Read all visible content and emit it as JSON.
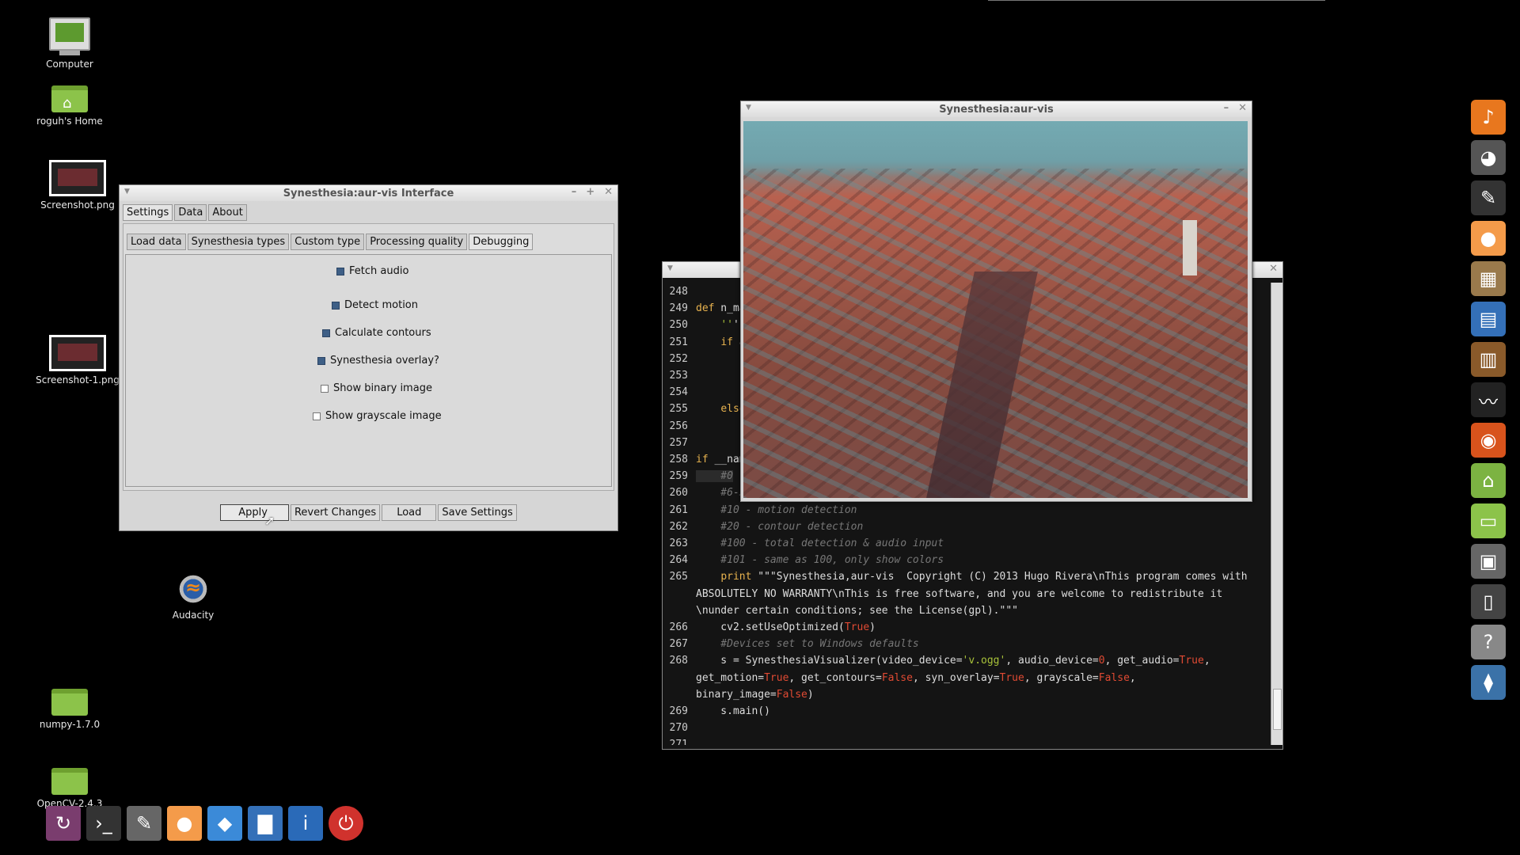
{
  "desktop": {
    "icons": [
      {
        "label": "Computer",
        "icon": "computer-icon"
      },
      {
        "label": "roguh's Home",
        "icon": "home-folder-icon"
      },
      {
        "label": "Screenshot.png",
        "icon": "image-file-icon"
      },
      {
        "label": "Screenshot-1.png",
        "icon": "image-file-icon"
      },
      {
        "label": "Audacity",
        "icon": "audacity-icon"
      },
      {
        "label": "numpy-1.7.0",
        "icon": "folder-icon"
      },
      {
        "label": "OpenCV-2.4.3",
        "icon": "folder-icon"
      }
    ]
  },
  "settings_window": {
    "title": "Synesthesia:aur-vis Interface",
    "tabs": [
      "Settings",
      "Data",
      "About"
    ],
    "subtabs": [
      "Load data",
      "Synesthesia types",
      "Custom type",
      "Processing quality",
      "Debugging"
    ],
    "active_subtab": "Debugging",
    "options": [
      {
        "label": "Fetch audio",
        "checked": true
      },
      {
        "label": "Detect motion",
        "checked": true
      },
      {
        "label": "Calculate contours",
        "checked": true
      },
      {
        "label": "Synesthesia overlay?",
        "checked": true
      },
      {
        "label": "Show binary image",
        "checked": false
      },
      {
        "label": "Show grayscale image",
        "checked": false
      }
    ],
    "buttons": [
      "Apply",
      "Revert Changes",
      "Load",
      "Save Settings"
    ]
  },
  "video_window": {
    "title": "Synesthesia:aur-vis"
  },
  "editor": {
    "lines": [
      {
        "n": "248",
        "text": ""
      },
      {
        "n": "249",
        "text": "def n_ma"
      },
      {
        "n": "250",
        "text": "    '''F"
      },
      {
        "n": "251",
        "text": "    if a"
      },
      {
        "n": "252",
        "text": ""
      },
      {
        "n": "253",
        "text": ""
      },
      {
        "n": "254",
        "text": ""
      },
      {
        "n": "255",
        "text": "    else"
      },
      {
        "n": "256",
        "text": ""
      },
      {
        "n": "257",
        "text": ""
      },
      {
        "n": "258",
        "text": "if __nam"
      },
      {
        "n": "259",
        "text": "    #0"
      },
      {
        "n": "260",
        "text": "    #6-5"
      },
      {
        "n": "261",
        "text": "    #10 - motion detection"
      },
      {
        "n": "262",
        "text": "    #20 - contour detection"
      },
      {
        "n": "263",
        "text": "    #100 - total detection & audio input"
      },
      {
        "n": "264",
        "text": "    #101 - same as 100, only show colors"
      },
      {
        "n": "265",
        "text": "    print \"\"\"Synesthesia,aur-vis  Copyright (C) 2013 Hugo Rivera\\nThis program comes with"
      },
      {
        "n": "",
        "text": "ABSOLUTELY NO WARRANTY\\nThis is free software, and you are welcome to redistribute it"
      },
      {
        "n": "",
        "text": "\\nunder certain conditions; see the License(gpl).\"\"\""
      },
      {
        "n": "266",
        "text": "    cv2.setUseOptimized(True)"
      },
      {
        "n": "267",
        "text": "    #Devices set to Windows defaults"
      },
      {
        "n": "268",
        "text": "    s = SynesthesiaVisualizer(video_device='v.ogg', audio_device=0, get_audio=True,"
      },
      {
        "n": "",
        "text": "get_motion=True, get_contours=False, syn_overlay=True, grayscale=False,"
      },
      {
        "n": "",
        "text": "binary_image=False)"
      },
      {
        "n": "269",
        "text": "    s.main()"
      },
      {
        "n": "270",
        "text": ""
      },
      {
        "n": "271",
        "text": ""
      }
    ]
  },
  "dock": {
    "items": [
      "audacious-icon",
      "gimp-icon",
      "inkscape-icon",
      "mint-icon",
      "archive-manager-icon",
      "document-icon",
      "library-icon",
      "system-monitor-icon",
      "firefox-icon",
      "home-folder-icon",
      "folder-icon",
      "file-manager-icon",
      "terminal-windows-icon",
      "help-icon",
      "python-icon"
    ]
  },
  "launcher": {
    "items": [
      "update-manager-icon",
      "terminal-icon",
      "text-editor-icon",
      "mint-menu-icon",
      "dropbox-icon",
      "system-stats-icon",
      "system-info-icon",
      "power-icon"
    ]
  }
}
